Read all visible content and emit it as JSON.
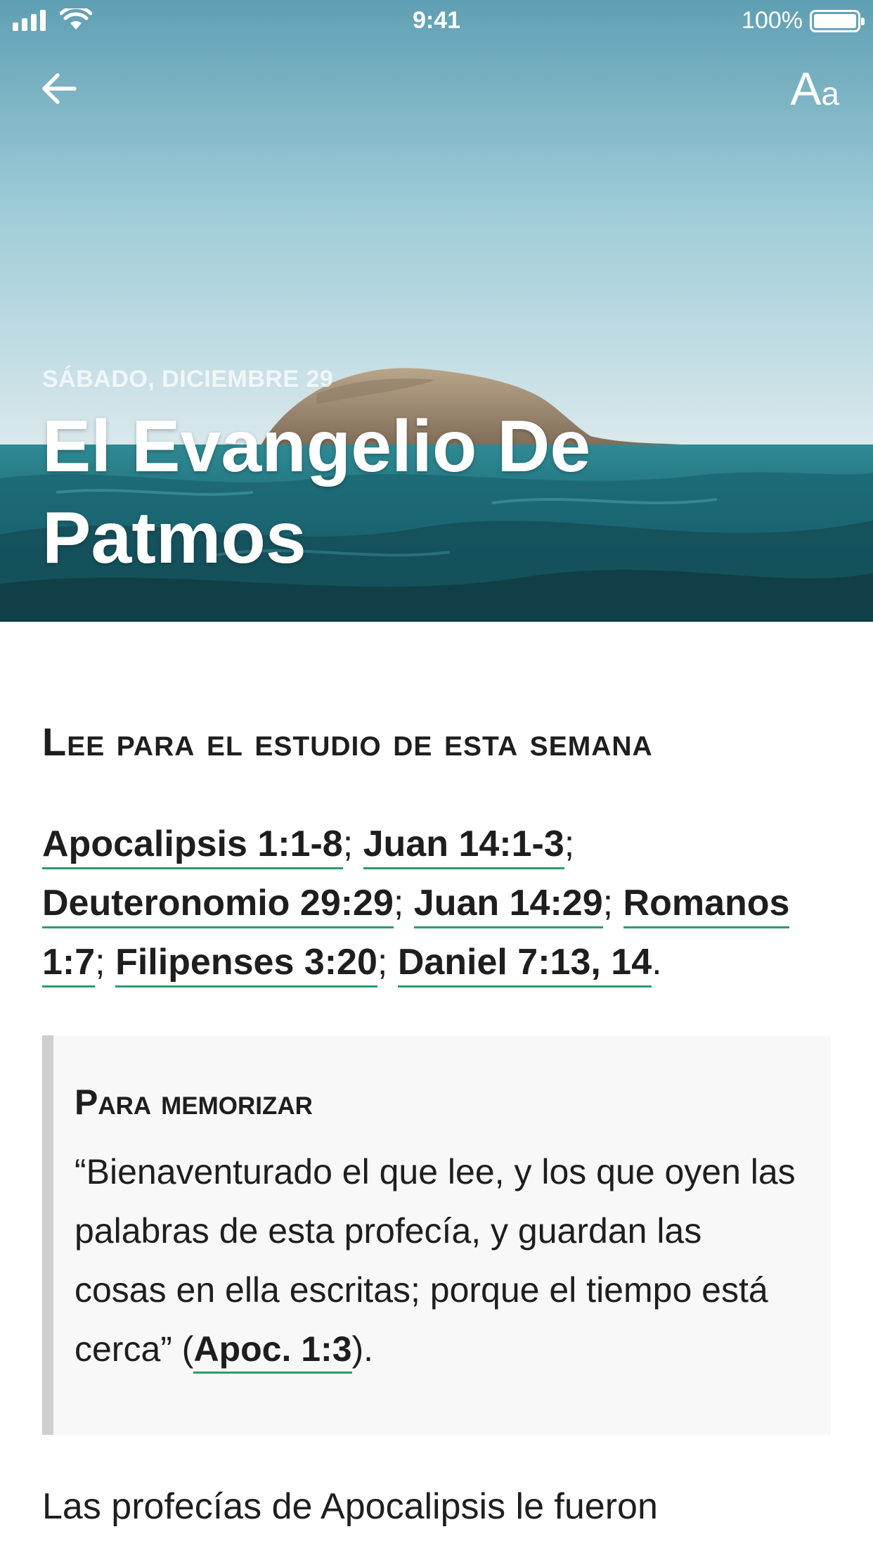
{
  "status_bar": {
    "time": "9:41",
    "battery_percent": "100%"
  },
  "nav": {
    "back_icon": "arrow-left-icon",
    "font_button": {
      "big": "A",
      "small": "a"
    }
  },
  "hero": {
    "date": "SÁBADO, DICIEMBRE 29",
    "title": "El Evangelio De Patmos"
  },
  "content": {
    "section_heading": "Lee para el estudio de esta semana",
    "readings": [
      "Apocalipsis 1:1-8",
      "Juan 14:1-3",
      "Deuteronomio 29:29",
      "Juan 14:29",
      "Romanos 1:7",
      "Filipenses 3:20",
      "Daniel 7:13, 14"
    ],
    "separator": "; ",
    "end_punct": ".",
    "memory": {
      "title": "Para memorizar",
      "quote": "“Bienaventurado el que lee, y los que oyen las palabras de esta profecía, y guardan las cosas en ella escritas; porque el tiempo está cerca” (",
      "reference": "Apoc. 1:3",
      "quote_end": ")."
    },
    "body_start": "Las profecías de Apocalipsis le fueron"
  },
  "colors": {
    "link_underline": "#2b9d6a",
    "memory_bar": "#cfcfcf",
    "memory_bg": "#f8f8f8"
  }
}
